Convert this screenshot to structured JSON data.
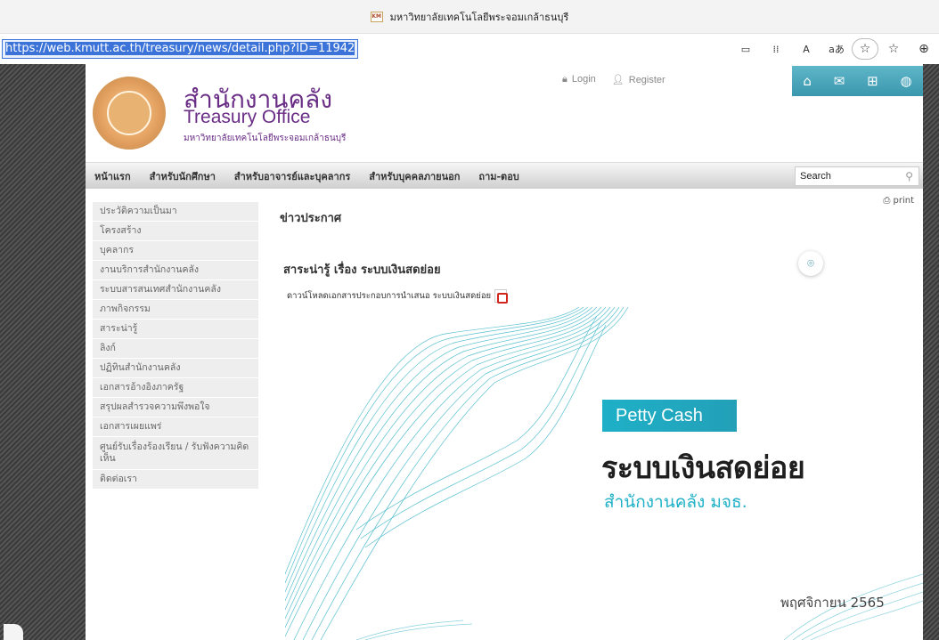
{
  "browser": {
    "tab_title": "มหาวิทยาลัยเทคโนโลยีพระจอมเกล้าธนบุรี",
    "favicon": "kmutt-favicon",
    "url": "https://web.kmutt.ac.th/treasury/news/detail.php?ID=11942",
    "toolbar_icons": [
      "reader-view-icon",
      "apps-icon",
      "read-aloud-icon",
      "translate-icon",
      "favorite-add-icon",
      "favorites-icon",
      "collections-icon"
    ],
    "read_aloud_label": "A",
    "translate_label": "aあ"
  },
  "header": {
    "office_th": "สำนักงานคลัง",
    "office_en": "Treasury Office",
    "university_th": "มหาวิทยาลัยเทคโนโลยีพระจอมเกล้าธนบุรี",
    "login": "Login",
    "register": "Register",
    "quick_icons": [
      "home-icon",
      "mail-icon",
      "sitemap-icon",
      "globe-icon"
    ]
  },
  "menu": {
    "items": [
      "หน้าแรก",
      "สำหรับนักศึกษา",
      "สำหรับอาจารย์และบุคลากร",
      "สำหรับบุคคลภายนอก",
      "ถาม-ตอบ"
    ],
    "search_placeholder": "Search"
  },
  "sidebar": {
    "items": [
      "ประวัติความเป็นมา",
      "โครงสร้าง",
      "บุคลากร",
      "งานบริการสำนักงานคลัง",
      "ระบบสารสนเทศสำนักงานคลัง",
      "ภาพกิจกรรม",
      "สาระน่ารู้",
      "ลิงก์",
      "ปฏิทินสำนักงานคลัง",
      "เอกสารอ้างอิงภาครัฐ",
      "สรุปผลสำรวจความพึงพอใจ",
      "เอกสารเผยแพร่",
      "ศูนย์รับเรื่องร้องเรียน / รับฟังความคิดเห็น",
      "ติดต่อเรา"
    ]
  },
  "main": {
    "print_label": "print",
    "section_heading": "ข่าวประกาศ",
    "article_title": "สาระน่ารู้ เรื่อง ระบบเงินสดย่อย",
    "download_text": "ดาวน์โหลดเอกสารประกอบการนำเสนอ ระบบเงินสดย่อย"
  },
  "poster": {
    "tag": "Petty Cash",
    "headline": "ระบบเงินสดย่อย",
    "subline": "สำนักงานคลัง มจธ.",
    "date": "พฤศจิกายน 2565",
    "accent_color": "#1eb0c7"
  },
  "colors": {
    "brand_purple": "#6a2d86",
    "teal": "#3a97ad"
  }
}
